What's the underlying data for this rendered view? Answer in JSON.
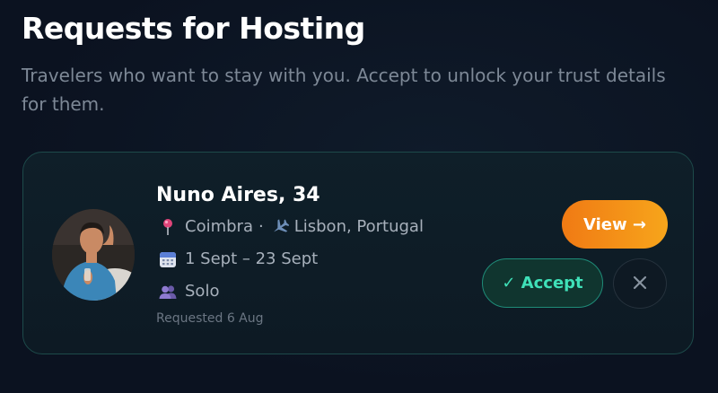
{
  "header": {
    "title": "Requests for Hosting",
    "subtitle": "Travelers who want to stay with you. Accept to unlock your trust details for them."
  },
  "request": {
    "name_age": "Nuno Aires, 34",
    "home_city": "Coimbra",
    "separator": "·",
    "destination": "Lisbon, Portugal",
    "dates": "1 Sept – 23 Sept",
    "party": "Solo",
    "requested": "Requested 6 Aug",
    "icons": {
      "home": "pin-icon",
      "destination": "airplane-icon",
      "dates": "calendar-icon",
      "party": "people-icon"
    }
  },
  "actions": {
    "view_label": "View →",
    "accept_label": "✓ Accept",
    "decline_icon": "close-icon"
  },
  "colors": {
    "background": "#0b1220",
    "view_button": "#f7931a",
    "accept_text": "#3fe0b8",
    "card_border": "#1d4a4a"
  }
}
